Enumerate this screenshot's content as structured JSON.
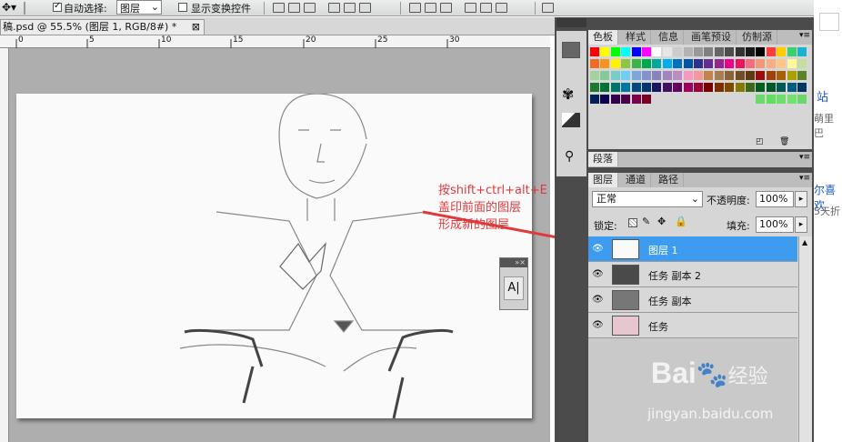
{
  "options_bar": {
    "auto_select_label": "自动选择:",
    "auto_select_value": "图层",
    "show_transform_label": "显示变换控件"
  },
  "document": {
    "tab_title": "稿.psd @ 55.5% (图层 1, RGB/8#) *",
    "close_glyph": "⊠",
    "ruler_marks": [
      "0",
      "5",
      "10",
      "15",
      "20",
      "25",
      "30"
    ]
  },
  "annotation": {
    "line1": "按shift+ctrl+alt+E",
    "line2": "盖印前面的图层",
    "line3": "形成新的图层",
    "arrow_color": "#e0393b"
  },
  "char_panel": {
    "label": "A|"
  },
  "swatches_panel": {
    "tabs": [
      "色板",
      "样式",
      "信息",
      "画笔预设",
      "仿制源"
    ],
    "active_tab": "色板"
  },
  "paragraph_panel": {
    "tab": "段落"
  },
  "layers_panel": {
    "tabs": [
      "图层",
      "通道",
      "路径"
    ],
    "blend_mode": "正常",
    "opacity_label": "不透明度:",
    "opacity_value": "100%",
    "lock_label": "锁定:",
    "fill_label": "填充:",
    "fill_value": "100%",
    "layers": [
      {
        "name": "图层 1",
        "selected": true
      },
      {
        "name": "任务 副本 2",
        "selected": false
      },
      {
        "name": "任务 副本",
        "selected": false
      },
      {
        "name": "任务",
        "selected": false
      }
    ]
  },
  "right_page": {
    "snippet1": "站",
    "snippet2": "萌里巴",
    "snippet3": "尔喜欢",
    "snippet4": "5天折"
  },
  "watermark": {
    "brand": "Bai",
    "brand2": "经验",
    "url": "jingyan.baidu.com"
  },
  "colors": {
    "selection": "#3d9cf0",
    "dock_bg": "#4b4b4b",
    "canvas_bg": "#aeaeae"
  }
}
